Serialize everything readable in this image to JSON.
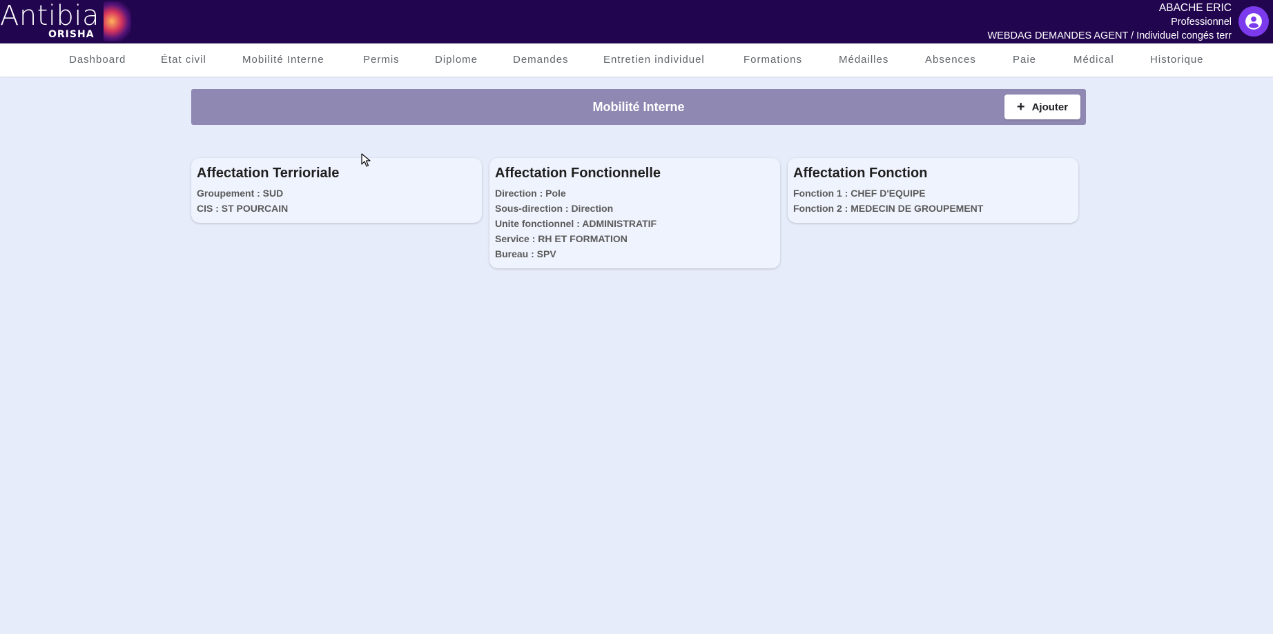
{
  "header": {
    "logo_main": "Antibia",
    "logo_sub": "ORISHA",
    "user_name": "ABACHE ERIC",
    "user_role": "Professionnel",
    "user_context": "WEBDAG DEMANDES AGENT / Individuel congés terr",
    "avatar_icon": "account-circle-icon"
  },
  "nav": {
    "items": [
      {
        "label": "Dashboard"
      },
      {
        "label": "État civil"
      },
      {
        "label": "Mobilité Interne"
      },
      {
        "label": "Permis"
      },
      {
        "label": "Diplome"
      },
      {
        "label": "Demandes"
      },
      {
        "label": "Entretien individuel"
      },
      {
        "label": "Formations"
      },
      {
        "label": "Médailles"
      },
      {
        "label": "Absences"
      },
      {
        "label": "Paie"
      },
      {
        "label": "Médical"
      },
      {
        "label": "Historique"
      }
    ]
  },
  "section": {
    "title": "Mobilité Interne",
    "add_label": "Ajouter"
  },
  "cards": [
    {
      "title": "Affectation Terrioriale",
      "lines": [
        "Groupement : SUD",
        "CIS : ST POURCAIN"
      ]
    },
    {
      "title": "Affectation Fonctionnelle",
      "lines": [
        "Direction : Pole",
        "Sous-direction : Direction",
        "Unite fonctionnel : ADMINISTRATIF",
        "Service : RH ET FORMATION",
        "Bureau : SPV"
      ]
    },
    {
      "title": "Affectation Fonction",
      "lines": [
        "Fonction 1 : CHEF D'EQUIPE",
        "Fonction 2 : MEDECIN DE GROUPEMENT"
      ]
    }
  ],
  "colors": {
    "header_bg": "#22054f",
    "section_bg": "#8f88b2",
    "page_bg": "#e7ecfb",
    "avatar": "#7c3aed"
  }
}
